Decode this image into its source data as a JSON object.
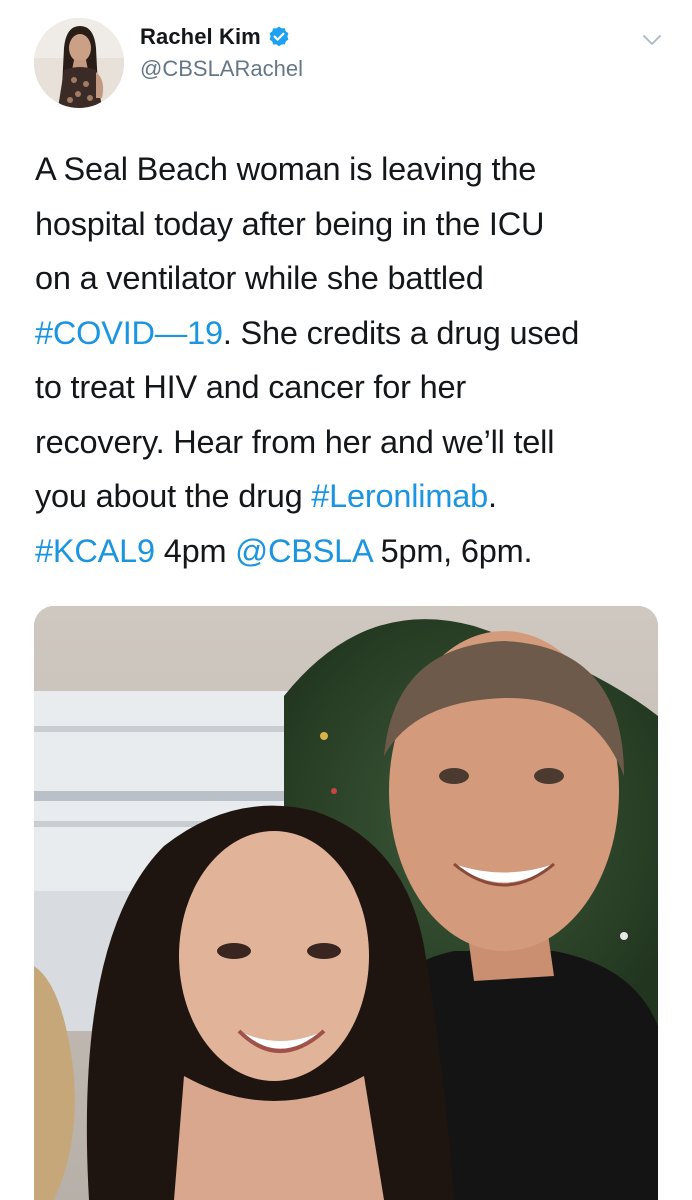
{
  "author": {
    "display_name": "Rachel Kim",
    "handle": "@CBSLARachel",
    "verified": true,
    "avatar_icon": "profile-photo"
  },
  "menu_icon": "chevron-down-icon",
  "tweet": {
    "lines": [
      [
        {
          "text": "A Seal Beach woman is leaving the",
          "link": false
        }
      ],
      [
        {
          "text": "hospital today after being in the ICU",
          "link": false
        }
      ],
      [
        {
          "text": "on a ventilator while she battled",
          "link": false
        }
      ],
      [
        {
          "text": "#COVID—19",
          "link": true
        },
        {
          "text": ".  She credits a drug used",
          "link": false
        }
      ],
      [
        {
          "text": "to treat HIV and cancer for her",
          "link": false
        }
      ],
      [
        {
          "text": "recovery.  Hear from her and we’ll tell",
          "link": false
        }
      ],
      [
        {
          "text": "you about the drug ",
          "link": false
        },
        {
          "text": "#Leronlimab",
          "link": true
        },
        {
          "text": ".",
          "link": false
        }
      ],
      [
        {
          "text": "#KCAL9",
          "link": true
        },
        {
          "text": " 4pm ",
          "link": false
        },
        {
          "text": "@CBSLA",
          "link": true
        },
        {
          "text": " 5pm, 6pm.",
          "link": false
        }
      ]
    ]
  },
  "photo": {
    "subject": "photo of a smiling woman and man in front of a christmas tree"
  },
  "colors": {
    "link": "#1b95e0",
    "text": "#14171a",
    "secondary": "#657786",
    "verified_badge": "#1da1f2"
  }
}
